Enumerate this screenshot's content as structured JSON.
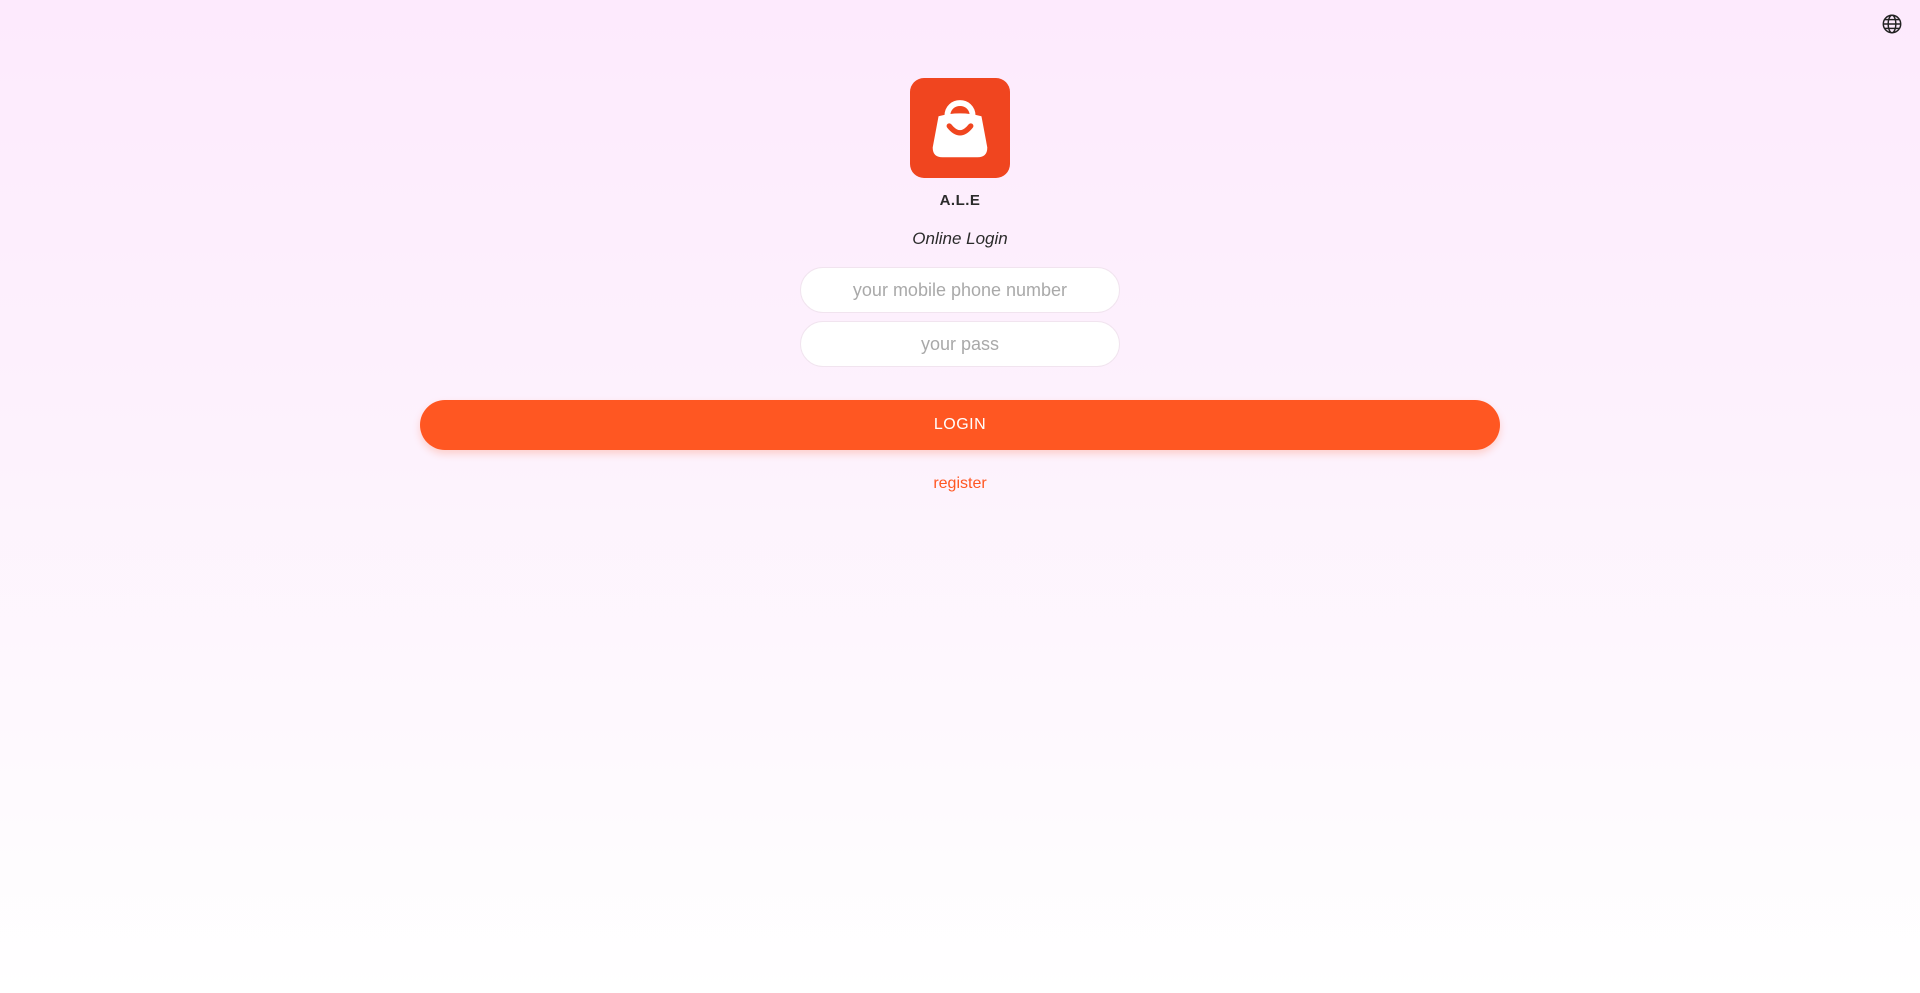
{
  "header": {
    "language_icon": "globe-icon"
  },
  "brand": {
    "logo_icon": "shopping-bag-icon",
    "name": "A.L.E",
    "color": "#f0451f"
  },
  "login": {
    "subtitle": "Online Login",
    "phone_placeholder": "your mobile phone number",
    "phone_value": "",
    "password_placeholder": "your pass",
    "password_value": "",
    "login_label": "LOGIN",
    "register_label": "register",
    "accent_color": "#ff5722"
  }
}
